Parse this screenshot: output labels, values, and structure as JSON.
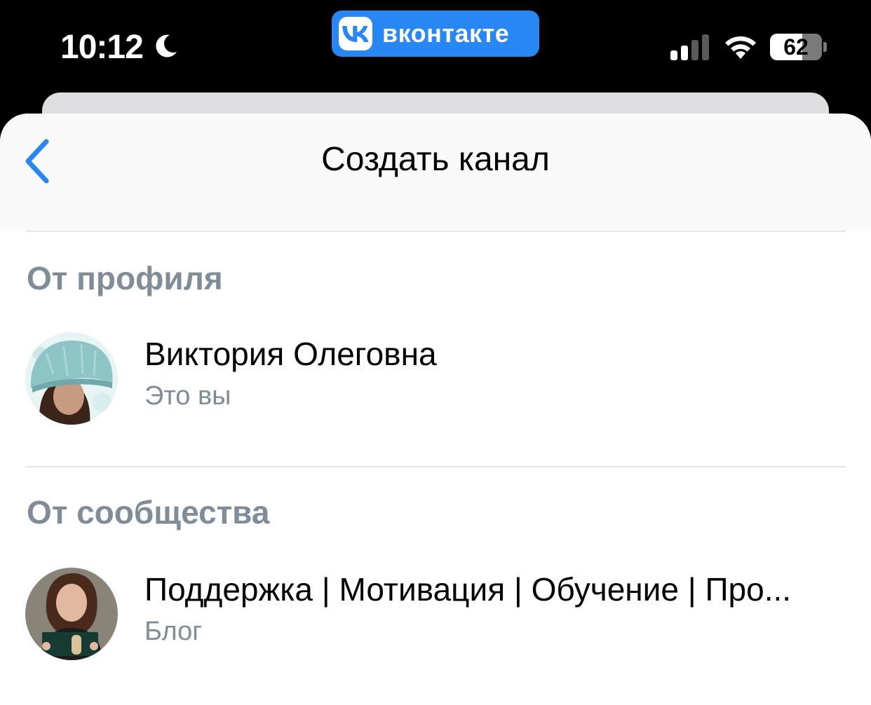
{
  "status_bar": {
    "time": "10:12",
    "moon_icon": "moon-icon",
    "app_badge": "вконтакте",
    "battery_level": "62",
    "signal_icon": "cellular-signal-icon",
    "wifi_icon": "wifi-icon"
  },
  "nav": {
    "title": "Создать канал",
    "back_icon": "chevron-left-icon"
  },
  "sections": [
    {
      "header": "От профиля",
      "items": [
        {
          "title": "Виктория Олеговна",
          "subtitle": "Это вы"
        }
      ]
    },
    {
      "header": "От сообщества",
      "items": [
        {
          "title": "Поддержка | Мотивация | Обучение | Про...",
          "subtitle": "Блог"
        }
      ]
    }
  ],
  "colors": {
    "accent": "#2787f5",
    "secondary_text": "#818c99",
    "separator": "#e6e7ea"
  }
}
